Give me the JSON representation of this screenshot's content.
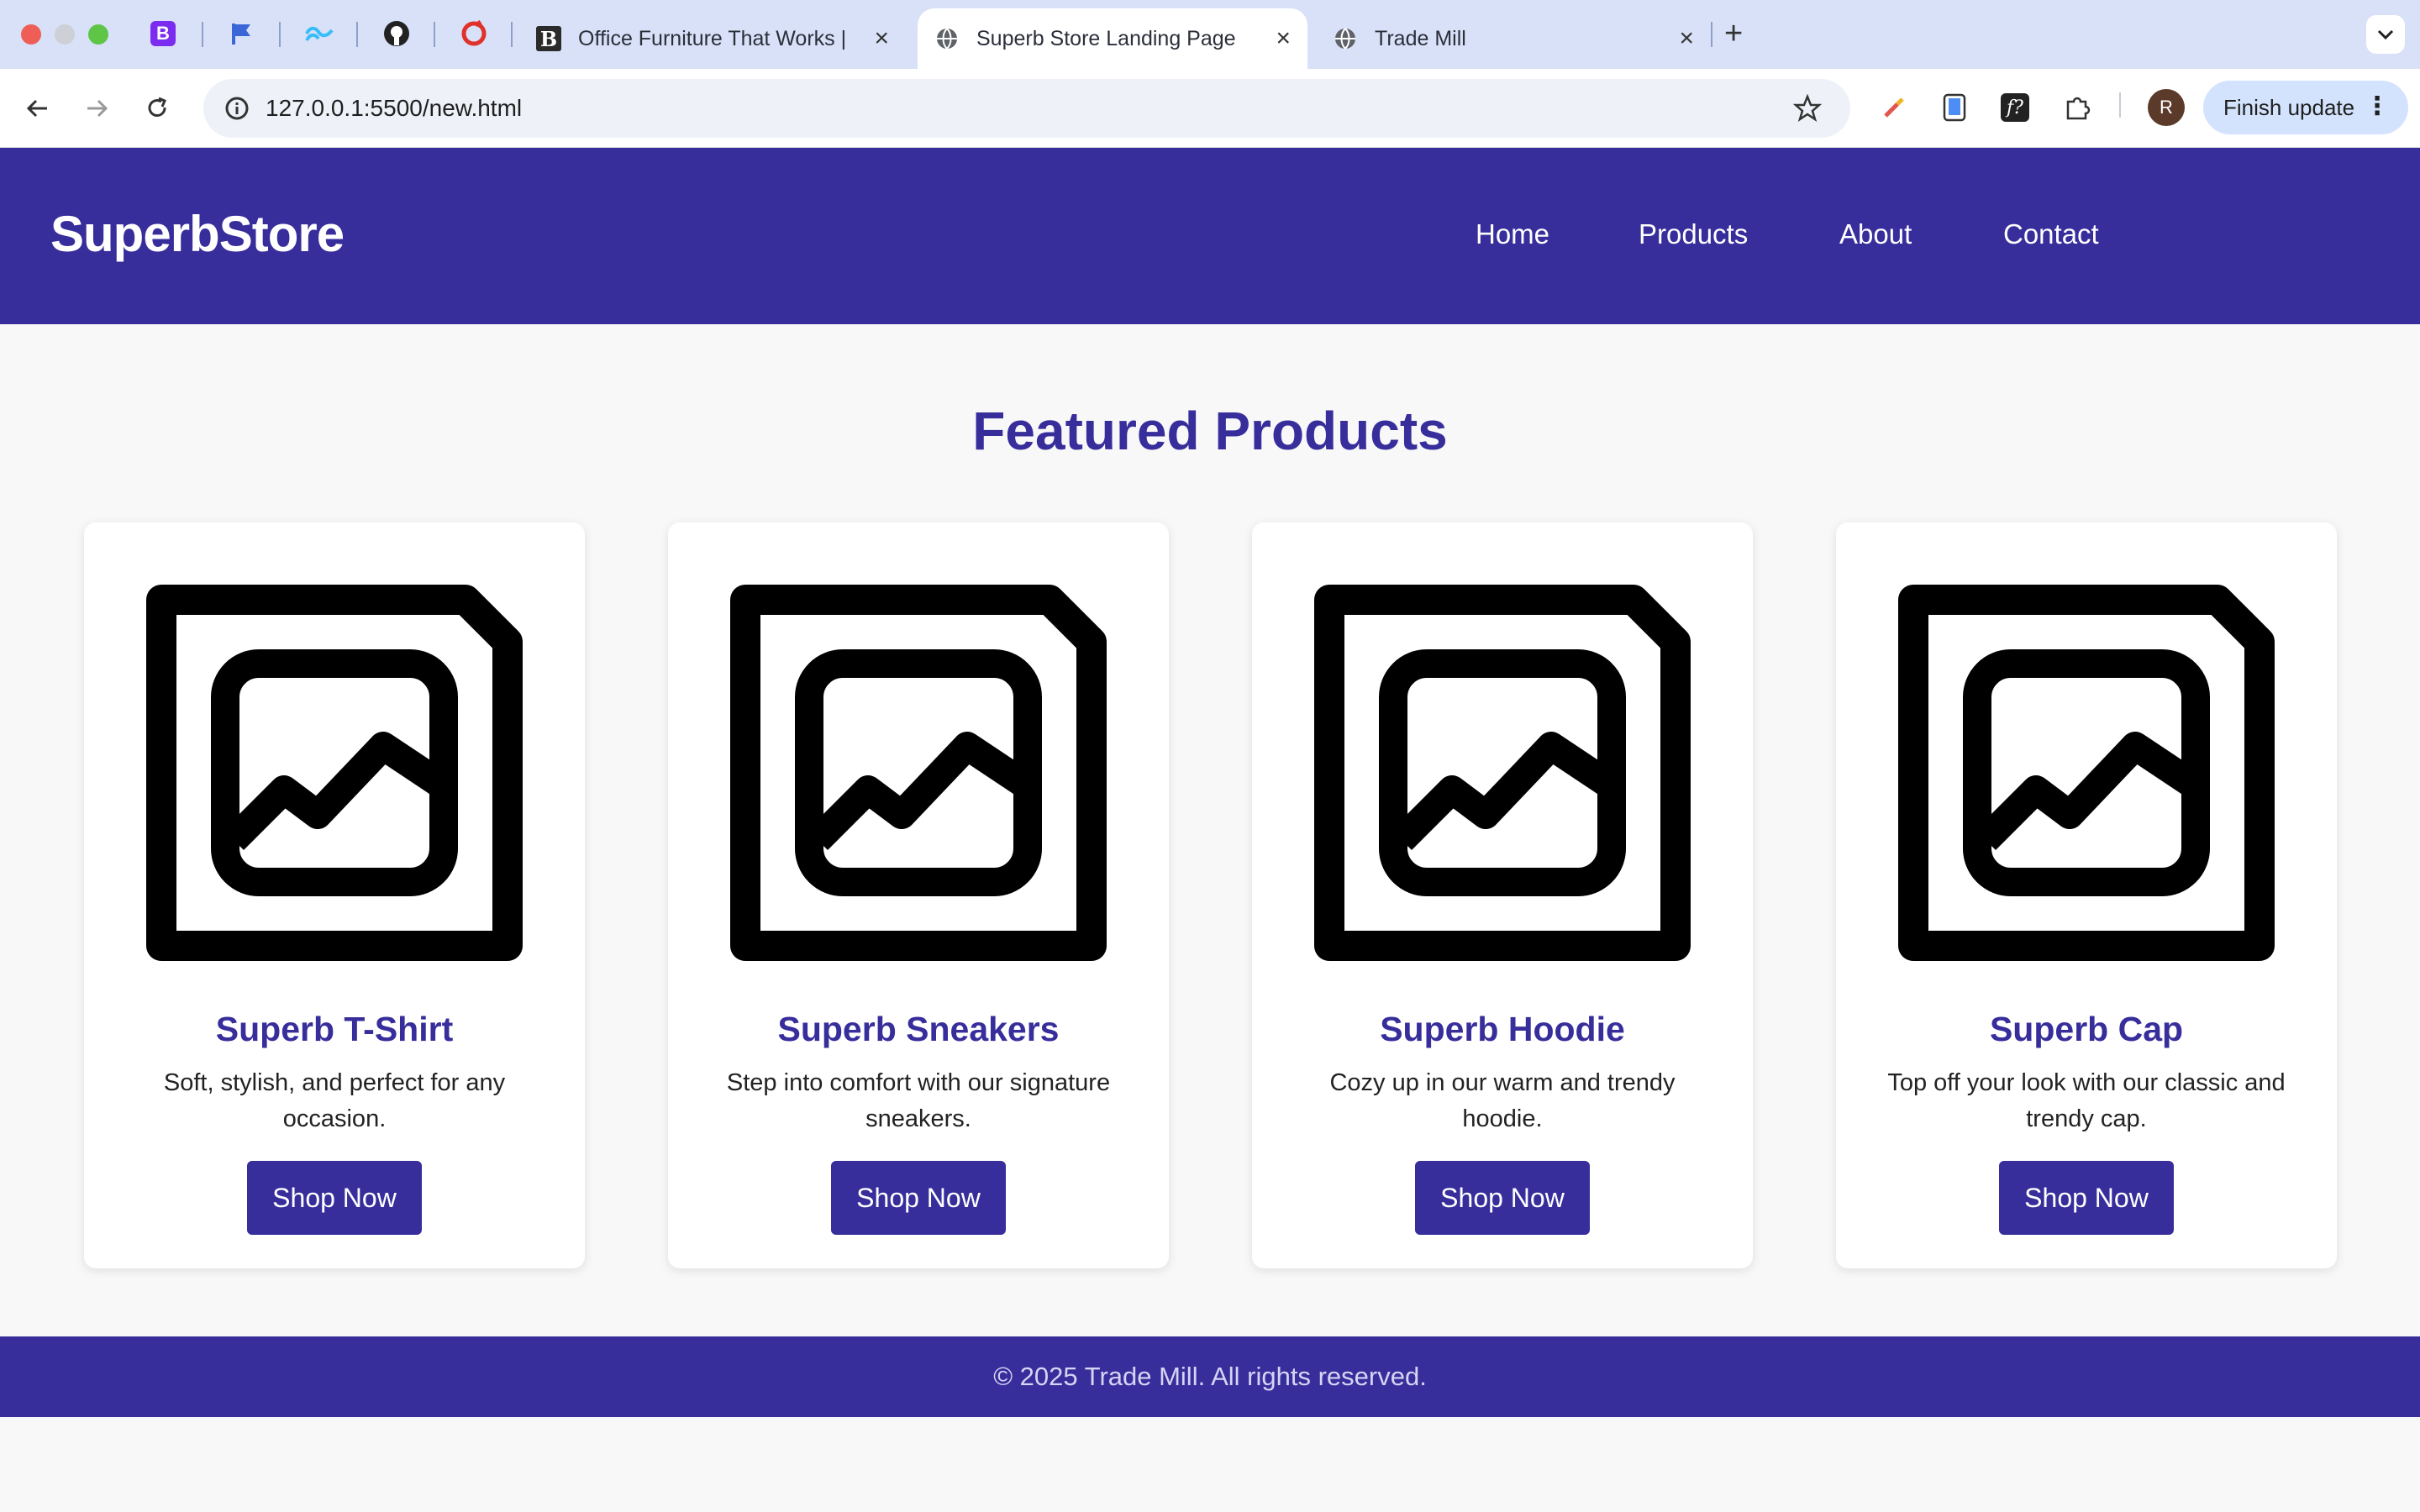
{
  "browser": {
    "tabs": [
      {
        "title": "Office Furniture That Works |",
        "favicon": "bootstrap-b-icon",
        "active": false
      },
      {
        "title": "Superb Store Landing Page",
        "favicon": "globe-icon",
        "active": true
      },
      {
        "title": "Trade Mill",
        "favicon": "globe-icon",
        "active": false
      }
    ],
    "pinned_tabs": [
      "bootstrap-icon",
      "flag-icon",
      "tailwind-icon",
      "github-icon",
      "red-app-icon"
    ],
    "url": "127.0.0.1:5500/new.html",
    "profile_initial": "R",
    "finish_update_label": "Finish update"
  },
  "site": {
    "logo": "SuperbStore",
    "nav": [
      "Home",
      "Products",
      "About",
      "Contact"
    ],
    "brand_color": "#372e9c"
  },
  "main": {
    "section_title": "Featured Products",
    "products": [
      {
        "title": "Superb T-Shirt",
        "description": "Soft, stylish, and perfect for any occasion.",
        "button": "Shop Now",
        "icon": "image-placeholder-icon"
      },
      {
        "title": "Superb Sneakers",
        "description": "Step into comfort with our signature sneakers.",
        "button": "Shop Now",
        "icon": "image-placeholder-icon"
      },
      {
        "title": "Superb Hoodie",
        "description": "Cozy up in our warm and trendy hoodie.",
        "button": "Shop Now",
        "icon": "image-placeholder-icon"
      },
      {
        "title": "Superb Cap",
        "description": "Top off your look with our classic and trendy cap.",
        "button": "Shop Now",
        "icon": "image-placeholder-icon"
      }
    ]
  },
  "footer": {
    "copyright": "© 2025 Trade Mill. All rights reserved."
  }
}
